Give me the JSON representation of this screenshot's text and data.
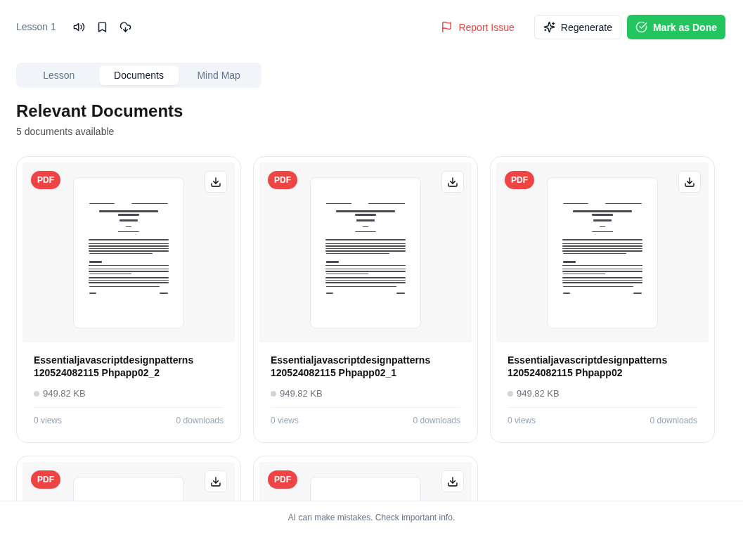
{
  "header": {
    "lesson_label": "Lesson 1",
    "report_button": "Report Issue",
    "regenerate_button": "Regenerate",
    "done_button": "Mark as Done"
  },
  "tabs": [
    {
      "label": "Lesson",
      "selected": false
    },
    {
      "label": "Documents",
      "selected": true
    },
    {
      "label": "Mind Map",
      "selected": false
    }
  ],
  "section": {
    "title": "Relevant Documents",
    "subtitle": "5 documents available"
  },
  "documents": [
    {
      "badge": "PDF",
      "title": "Essentialjavascriptdesignpatterns 120524082115 Phpapp02_2",
      "size": "949.82 KB",
      "views": "0 views",
      "downloads": "0 downloads"
    },
    {
      "badge": "PDF",
      "title": "Essentialjavascriptdesignpatterns 120524082115 Phpapp02_1",
      "size": "949.82 KB",
      "views": "0 views",
      "downloads": "0 downloads"
    },
    {
      "badge": "PDF",
      "title": "Essentialjavascriptdesignpatterns 120524082115 Phpapp02",
      "size": "949.82 KB",
      "views": "0 views",
      "downloads": "0 downloads"
    },
    {
      "badge": "PDF"
    },
    {
      "badge": "PDF"
    }
  ],
  "footer": {
    "disclaimer": "AI can make mistakes. Check important info."
  }
}
